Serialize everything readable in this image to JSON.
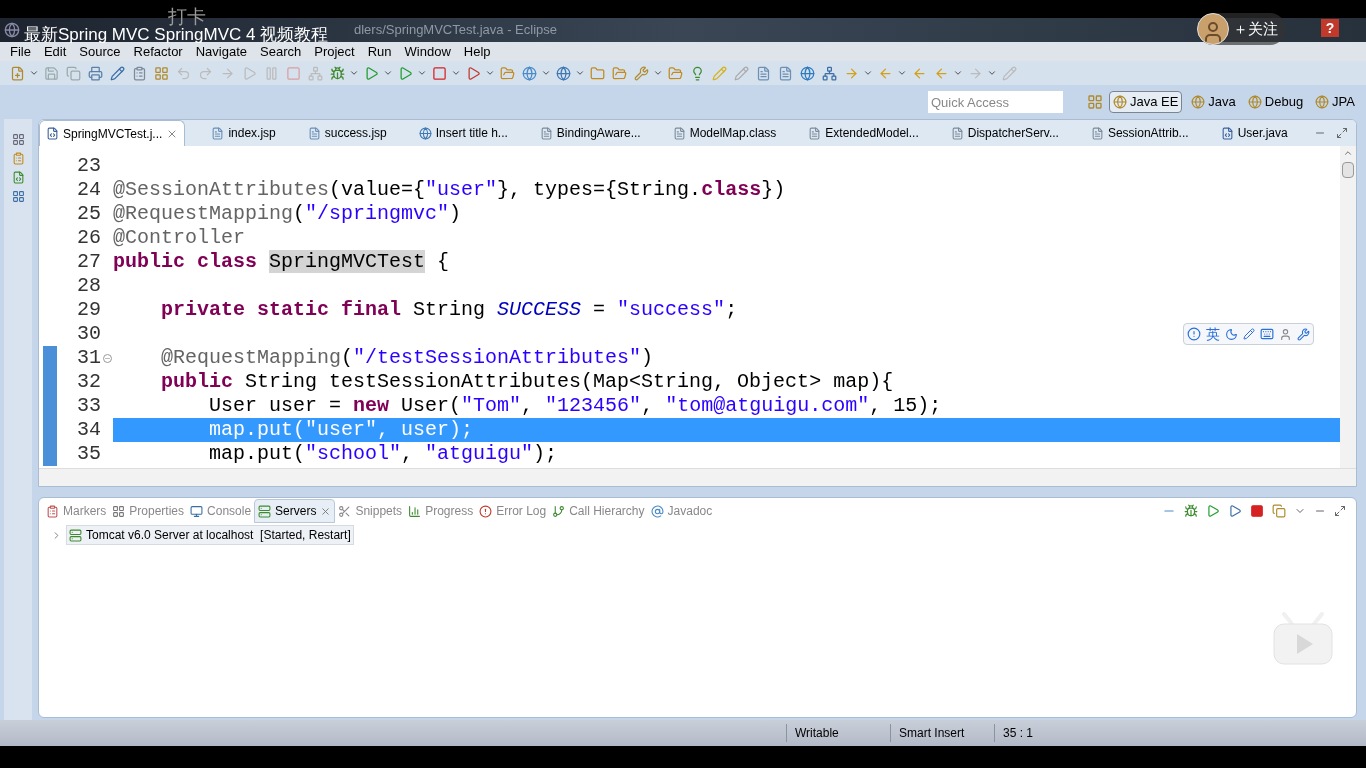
{
  "video_overlay": {
    "title": "最新Spring MVC SpringMVC 4 视频教程",
    "checkin": "打卡",
    "follow": "＋关注",
    "help": "?"
  },
  "window": {
    "title": "dlers/SpringMVCTest.java - Eclipse"
  },
  "menu": [
    "File",
    "Edit",
    "Source",
    "Refactor",
    "Navigate",
    "Search",
    "Project",
    "Run",
    "Window",
    "Help"
  ],
  "quick_access": {
    "placeholder": "Quick Access"
  },
  "perspectives": [
    {
      "label": "Java EE",
      "selected": true
    },
    {
      "label": "Java",
      "selected": false
    },
    {
      "label": "Debug",
      "selected": false
    },
    {
      "label": "JPA",
      "selected": false
    }
  ],
  "editor_tabs": [
    {
      "label": "SpringMVCTest.j...",
      "kind": "java",
      "selected": true
    },
    {
      "label": "index.jsp",
      "kind": "jsp",
      "selected": false
    },
    {
      "label": "success.jsp",
      "kind": "jsp",
      "selected": false
    },
    {
      "label": "Insert title h...",
      "kind": "web",
      "selected": false
    },
    {
      "label": "BindingAware...",
      "kind": "class",
      "selected": false
    },
    {
      "label": "ModelMap.class",
      "kind": "class",
      "selected": false
    },
    {
      "label": "ExtendedModel...",
      "kind": "class",
      "selected": false
    },
    {
      "label": "DispatcherServ...",
      "kind": "class",
      "selected": false
    },
    {
      "label": "SessionAttrib...",
      "kind": "class",
      "selected": false
    },
    {
      "label": "User.java",
      "kind": "java",
      "selected": false
    }
  ],
  "code_lines": [
    {
      "number": "23",
      "selected": false,
      "range_marked": false,
      "fold_marker": false
    },
    {
      "number": "24",
      "selected": false,
      "range_marked": false,
      "fold_marker": false,
      "tokens": [
        {
          "t": "@SessionAttributes",
          "kind": "annotation"
        },
        {
          "t": "(value={",
          "kind": "plain"
        },
        {
          "t": "\"user\"",
          "kind": "string"
        },
        {
          "t": "}, types={String.",
          "kind": "plain"
        },
        {
          "t": "class",
          "kind": "keyword"
        },
        {
          "t": "})",
          "kind": "plain"
        }
      ]
    },
    {
      "number": "25",
      "selected": false,
      "range_marked": false,
      "fold_marker": false,
      "tokens": [
        {
          "t": "@RequestMapping",
          "kind": "annotation"
        },
        {
          "t": "(",
          "kind": "plain"
        },
        {
          "t": "\"/springmvc\"",
          "kind": "string"
        },
        {
          "t": ")",
          "kind": "plain"
        }
      ]
    },
    {
      "number": "26",
      "selected": false,
      "range_marked": false,
      "fold_marker": false,
      "tokens": [
        {
          "t": "@Controller",
          "kind": "annotation"
        }
      ]
    },
    {
      "number": "27",
      "selected": false,
      "range_marked": false,
      "fold_marker": false,
      "tokens": [
        {
          "t": "public class",
          "kind": "keyword"
        },
        {
          "t": "SpringMVCTest",
          "kind": "occurrence"
        },
        {
          "t": " {",
          "kind": "plain"
        }
      ]
    },
    {
      "number": "28",
      "selected": false,
      "range_marked": false,
      "fold_marker": false
    },
    {
      "number": "29",
      "selected": false,
      "range_marked": false,
      "fold_marker": false,
      "tokens": [
        {
          "t": "    private static final",
          "kind": "keyword"
        },
        {
          "t": " String ",
          "kind": "plain"
        },
        {
          "t": "SUCCESS",
          "kind": "constant"
        },
        {
          "t": " = ",
          "kind": "plain"
        },
        {
          "t": "\"success\"",
          "kind": "string"
        },
        {
          "t": ";",
          "kind": "plain"
        }
      ]
    },
    {
      "number": "30",
      "selected": false,
      "range_marked": false,
      "fold_marker": false
    },
    {
      "number": "31",
      "selected": false,
      "range_marked": true,
      "fold_marker": true,
      "tokens": [
        {
          "t": "    @RequestMapping",
          "kind": "annotation"
        },
        {
          "t": "(",
          "kind": "plain"
        },
        {
          "t": "\"/testSessionAttributes\"",
          "kind": "string"
        },
        {
          "t": ")",
          "kind": "plain"
        }
      ]
    },
    {
      "number": "32",
      "selected": false,
      "range_marked": true,
      "fold_marker": false,
      "tokens": [
        {
          "t": "    public",
          "kind": "keyword"
        },
        {
          "t": " String testSessionAttributes(Map<String, Object> map){",
          "kind": "plain"
        }
      ]
    },
    {
      "number": "33",
      "selected": false,
      "range_marked": true,
      "fold_marker": false,
      "tokens": [
        {
          "t": "        User user = ",
          "kind": "plain"
        },
        {
          "t": "new",
          "kind": "keyword"
        },
        {
          "t": " User(",
          "kind": "plain"
        },
        {
          "t": "\"Tom\"",
          "kind": "string"
        },
        {
          "t": ", ",
          "kind": "plain"
        },
        {
          "t": "\"123456\"",
          "kind": "string"
        },
        {
          "t": ", ",
          "kind": "plain"
        },
        {
          "t": "\"tom@atguigu.com\"",
          "kind": "string"
        },
        {
          "t": ", 15);",
          "kind": "plain"
        }
      ]
    },
    {
      "number": "34",
      "selected": true,
      "range_marked": true,
      "fold_marker": false,
      "tokens": [
        {
          "t": "        map.put(",
          "kind": "plain"
        },
        {
          "t": "\"user\"",
          "kind": "string"
        },
        {
          "t": ", user);",
          "kind": "plain"
        }
      ]
    },
    {
      "number": "35",
      "selected": false,
      "range_marked": true,
      "fold_marker": false,
      "tokens": [
        {
          "t": "        map.put(",
          "kind": "plain"
        },
        {
          "t": "\"school\"",
          "kind": "string"
        },
        {
          "t": ", ",
          "kind": "plain"
        },
        {
          "t": "\"atguigu\"",
          "kind": "string"
        },
        {
          "t": ");",
          "kind": "plain"
        }
      ]
    }
  ],
  "ime_bar": {
    "label": "英"
  },
  "bottom_tabs": [
    {
      "label": "Markers",
      "selected": false
    },
    {
      "label": "Properties",
      "selected": false
    },
    {
      "label": "Console",
      "selected": false
    },
    {
      "label": "Servers",
      "selected": true
    },
    {
      "label": "Snippets",
      "selected": false
    },
    {
      "label": "Progress",
      "selected": false
    },
    {
      "label": "Error Log",
      "selected": false
    },
    {
      "label": "Call Hierarchy",
      "selected": false
    },
    {
      "label": "Javadoc",
      "selected": false
    }
  ],
  "servers": [
    {
      "label": "Tomcat v6.0 Server at localhost  [Started, Restart]",
      "expanded": false
    }
  ],
  "status_bar": [
    "Writable",
    "Smart Insert",
    "35 : 1"
  ]
}
